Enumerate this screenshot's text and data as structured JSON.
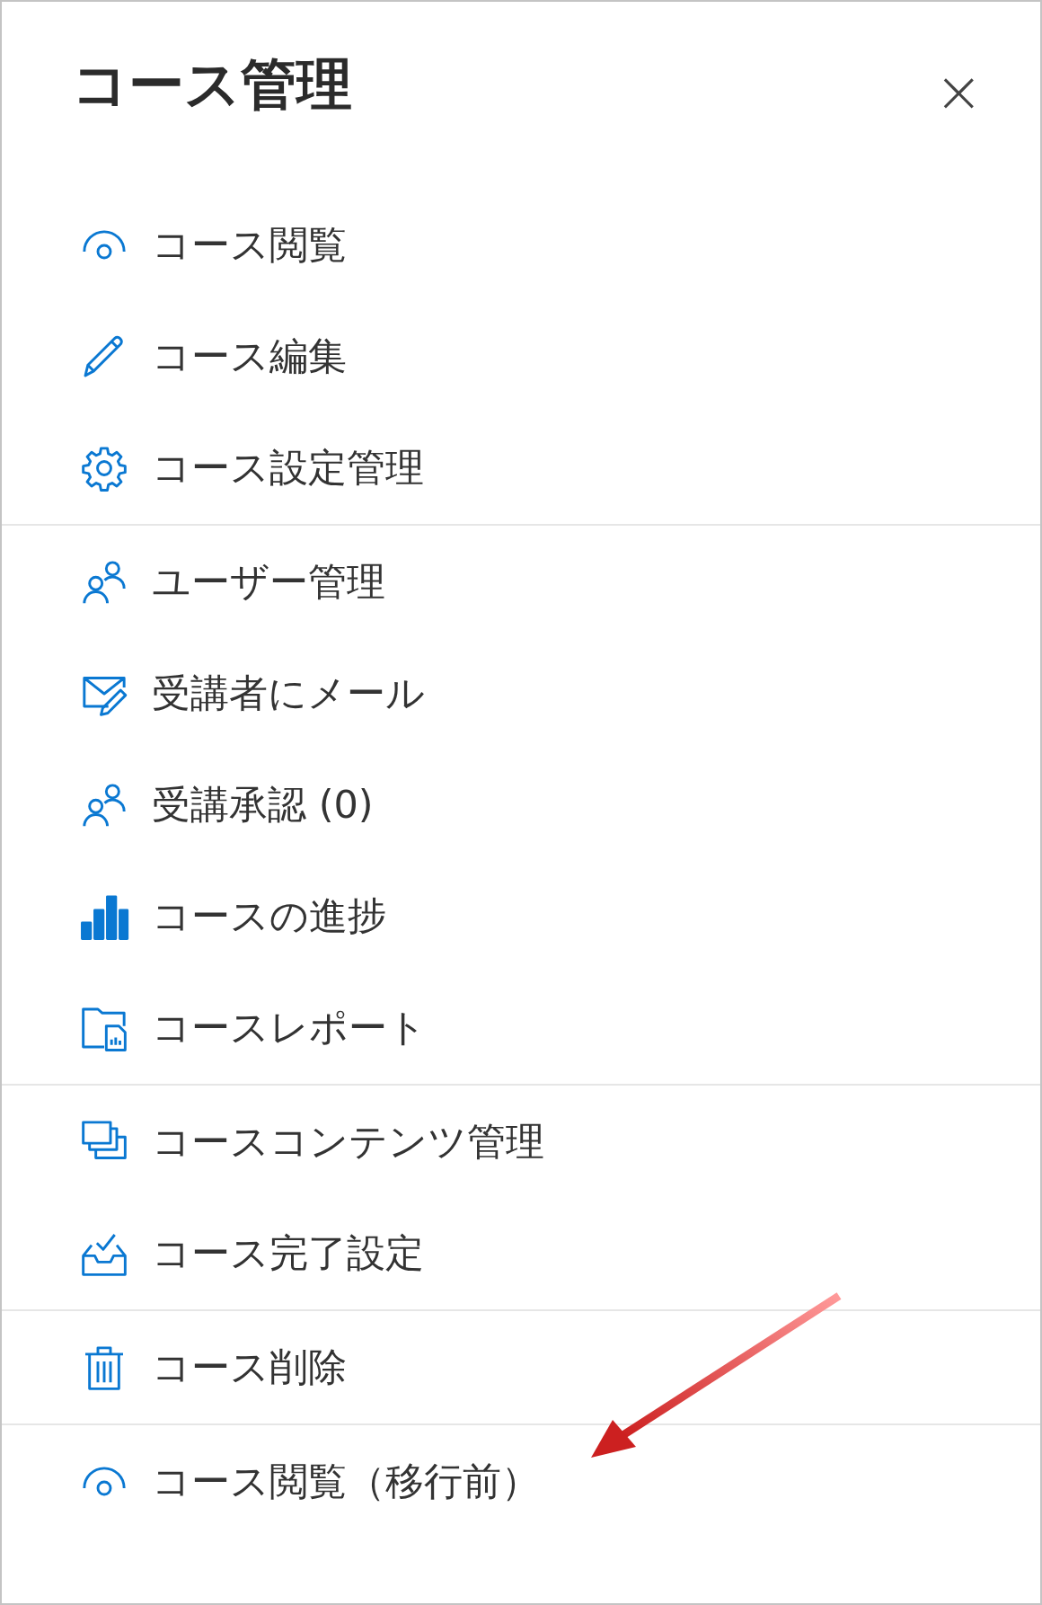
{
  "title": "コース管理",
  "close": {
    "label": "×"
  },
  "groups": [
    {
      "items": [
        {
          "label": "コース閲覧",
          "kind": "eye"
        },
        {
          "label": "コース編集",
          "kind": "pencil"
        },
        {
          "label": "コース設定管理",
          "kind": "gear"
        }
      ]
    },
    {
      "items": [
        {
          "label": "ユーザー管理",
          "kind": "people"
        },
        {
          "label": "受講者にメール",
          "kind": "mail"
        },
        {
          "label": "受講承認 (0)",
          "kind": "people"
        },
        {
          "label": "コースの進捗",
          "kind": "bars"
        },
        {
          "label": "コースレポート",
          "kind": "report"
        }
      ]
    },
    {
      "items": [
        {
          "label": "コースコンテンツ管理",
          "kind": "stack"
        },
        {
          "label": "コース完了設定",
          "kind": "inbox"
        }
      ]
    },
    {
      "items": [
        {
          "label": "コース削除",
          "kind": "trash"
        }
      ]
    },
    {
      "items": [
        {
          "label": "コース閲覧（移行前）",
          "kind": "eye"
        }
      ]
    }
  ]
}
